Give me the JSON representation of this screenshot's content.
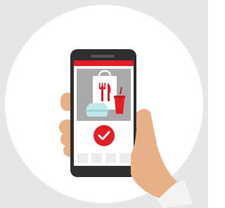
{
  "scene": {
    "description_icons": [
      "shopping-bag-icon",
      "fork-icon",
      "knife-icon",
      "takeaway-box-icon",
      "drink-cup-icon",
      "checkmark-icon"
    ],
    "colors": {
      "background_outer": "#e6e6e6",
      "circle": "#ffffff",
      "phone_body": "#2f2f2f",
      "screen": "#ffffff",
      "status_bar": "#e31e26",
      "image_area": "#a9a9a9",
      "bag": "#ffffff",
      "cutlery": "#e31e26",
      "box": "#bfe8ea",
      "cup": "#e31e26",
      "confirm_button": "#e31e26",
      "checkmark": "#ffffff",
      "grid_cells": "#ececec",
      "hand": "#e8b086",
      "sleeve": "#f3f3f3"
    }
  }
}
